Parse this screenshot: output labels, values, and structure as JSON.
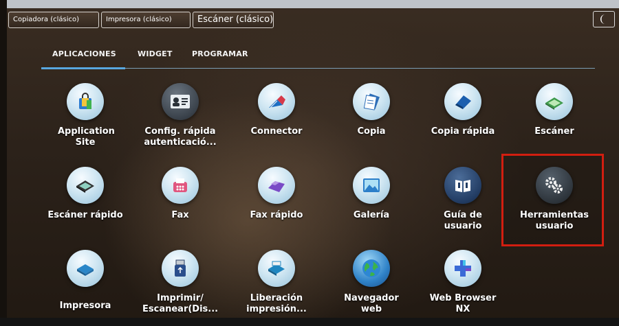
{
  "header": {
    "buttons": [
      "Copiadora (clásico)",
      "Impresora (clásico)",
      "Escáner (clásico)"
    ]
  },
  "tabs": [
    "APLICACIONES",
    "WIDGET",
    "PROGRAMAR"
  ],
  "apps": {
    "row1": [
      "Application Site",
      "Config. rápida autenticació...",
      "Connector",
      "Copia",
      "Copia rápida",
      "Escáner"
    ],
    "row2": [
      "Escáner rápido",
      "Fax",
      "Fax rápido",
      "Galería",
      "Guía de usuario",
      "Herramientas usuario"
    ],
    "row3": [
      "Impresora",
      "Imprimir/ Escanear(Dis...",
      "Liberación impresión...",
      "Navegador web",
      "Web Browser NX"
    ]
  },
  "colors": {
    "accent": "#58a7df",
    "highlight": "#d21e10"
  }
}
